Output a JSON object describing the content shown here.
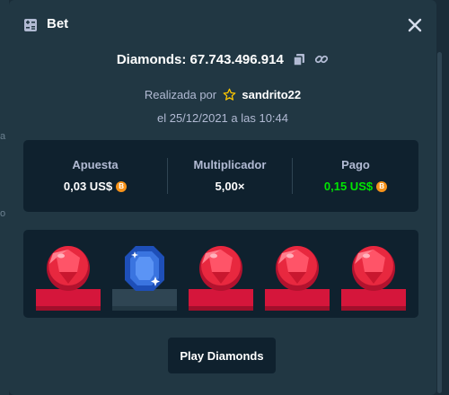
{
  "backdrop": {
    "fragment_1": "a",
    "fragment_2": "o"
  },
  "modal": {
    "title": "Bet",
    "game_name": "Diamonds:",
    "bet_id": "67.743.496.914",
    "placed_by_label": "Realizada por",
    "username": "sandrito22",
    "date_text": "el 25/12/2021 a las 10:44"
  },
  "stats": {
    "bet_label": "Apuesta",
    "bet_value": "0,03 US$",
    "multiplier_label": "Multiplicador",
    "multiplier_value": "5,00×",
    "payout_label": "Pago",
    "payout_value": "0,15 US$"
  },
  "board": {
    "gems": [
      {
        "type": "red-diamond",
        "pedestal": "red"
      },
      {
        "type": "blue-sapphire",
        "pedestal": "gray"
      },
      {
        "type": "red-diamond",
        "pedestal": "red"
      },
      {
        "type": "red-diamond",
        "pedestal": "red"
      },
      {
        "type": "red-diamond",
        "pedestal": "red"
      }
    ]
  },
  "play_button_label": "Play Diamonds",
  "colors": {
    "background": "#1a2c38",
    "panel": "#213743",
    "inner_panel": "#0f212e",
    "payout_green": "#00e701",
    "gem_red": "#e8283f",
    "gem_blue": "#3a74e0",
    "coin": "#f7931a"
  },
  "icons": [
    "bet-icon",
    "close-icon",
    "copy-icon",
    "link-icon",
    "star-icon",
    "bitcoin-icon"
  ]
}
